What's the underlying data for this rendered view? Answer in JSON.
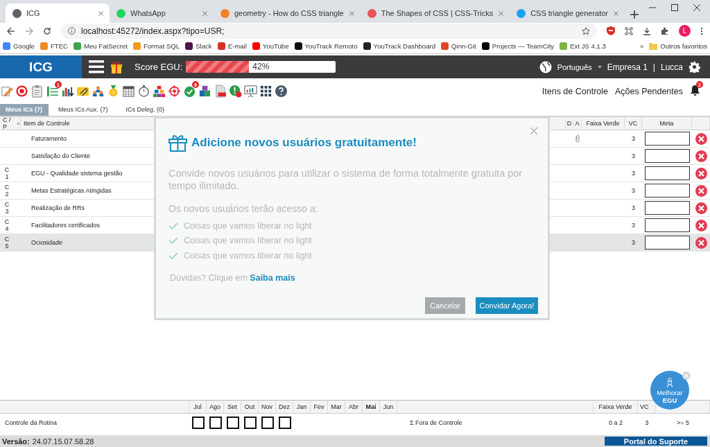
{
  "browser": {
    "tabs": [
      {
        "title": "ICG",
        "color": "#5f6368",
        "selected": true
      },
      {
        "title": "WhatsApp",
        "color": "#25d366",
        "selected": false
      },
      {
        "title": "geometry - How do CSS triangle",
        "color": "#f48024",
        "selected": false
      },
      {
        "title": "The Shapes of CSS | CSS-Tricks",
        "color": "#e8545a",
        "selected": false
      },
      {
        "title": "CSS triangle generator",
        "color": "#1da1f2",
        "selected": false
      }
    ],
    "url": "localhost:45272/index.aspx?tipo=USR;",
    "profile": "L",
    "bookmarks": [
      {
        "label": "Google",
        "color": "#4285f4"
      },
      {
        "label": "FTEC",
        "color": "#f08a24"
      },
      {
        "label": "Meu FatSecret",
        "color": "#3aa64a"
      },
      {
        "label": "Format SQL",
        "color": "#f29a1f"
      },
      {
        "label": "Slack",
        "color": "#4a154b"
      },
      {
        "label": "E-mail",
        "color": "#d93025"
      },
      {
        "label": "YouTube",
        "color": "#ff0000"
      },
      {
        "label": "YouTrack Remoto",
        "color": "#111111"
      },
      {
        "label": "YouTrack Dashboard",
        "color": "#222222"
      },
      {
        "label": "Qinn-Git",
        "color": "#e24329"
      },
      {
        "label": "Projects — TeamCity",
        "color": "#000000"
      },
      {
        "label": "Ext JS 4.1.3",
        "color": "#7cb342"
      }
    ],
    "more": "»",
    "other": "Outros favoritos"
  },
  "app": {
    "logo": "ICG",
    "score_label": "Score EGU:",
    "score": {
      "level": 0.42,
      "reading": "42%"
    },
    "language": "Português",
    "company": "Empresa 1",
    "separator": "|",
    "user": "Lucca"
  },
  "toolbar": {
    "icons": [
      {
        "kind": "pencil"
      },
      {
        "kind": "target"
      },
      {
        "kind": "clipboard"
      },
      {
        "kind": "list",
        "badge": "1"
      },
      {
        "kind": "chart"
      },
      {
        "kind": "paperclip"
      },
      {
        "kind": "people"
      },
      {
        "kind": "medal"
      },
      {
        "kind": "calendar"
      },
      {
        "kind": "stopwatch"
      },
      {
        "kind": "blocks"
      },
      {
        "kind": "crosshair"
      },
      {
        "kind": "check",
        "badge": "9"
      },
      {
        "kind": "puzzle"
      },
      {
        "kind": "pdf"
      },
      {
        "kind": "alert"
      },
      {
        "kind": "board"
      },
      {
        "kind": "grid"
      },
      {
        "kind": "help"
      }
    ],
    "links": [
      "Itens de Controle",
      "Ações Pendentes"
    ],
    "bell_badge": "2"
  },
  "tabs": [
    {
      "label": "Meus ICs (7)",
      "selected": true
    },
    {
      "label": "Meus ICs Aux. (7)",
      "selected": false
    },
    {
      "label": "ICs Deleg. (0)",
      "selected": false
    }
  ],
  "table": {
    "columns": [
      "C / P",
      "Item de Controle",
      "D",
      "A",
      "Faixa Verde",
      "VC",
      "Meta"
    ],
    "rows": [
      {
        "cp": "",
        "item": "Faturamento",
        "attachment": true,
        "vc": "3",
        "selected": false
      },
      {
        "cp": "",
        "item": "Satisfação do Cliente",
        "attachment": false,
        "vc": "3",
        "selected": false
      },
      {
        "cp": "C 1",
        "item": "EGU - Qualidade sistema gestão",
        "attachment": false,
        "vc": "3",
        "selected": false
      },
      {
        "cp": "C 2",
        "item": "Metas Estratégicas Atingidas",
        "attachment": false,
        "vc": "3",
        "selected": false
      },
      {
        "cp": "C 3",
        "item": "Realização de RRs",
        "attachment": false,
        "vc": "3",
        "selected": false
      },
      {
        "cp": "C 4",
        "item": "Facilitadores certificados",
        "attachment": false,
        "vc": "3",
        "selected": false
      },
      {
        "cp": "C 5",
        "item": "Ociosidade",
        "attachment": false,
        "vc": "3",
        "selected": true
      }
    ]
  },
  "modal": {
    "title": "Adicione novos usuários gratuitamente!",
    "text": "Convide novos usuários para utilizar o sistema de forma totalmente gratuita por tempo ilimitado.",
    "subtitle": "Os novos usuários terão acesso a:",
    "benefits": [
      "Coisas que vamos liberar no light",
      "Coisas que vamos liberar no light",
      "Coisas que vamos liberar no light"
    ],
    "help": "Dúvidas? Clique em",
    "help_link": "Saiba mais",
    "buttons": [
      {
        "label": "Cancelar",
        "kind": "secondary"
      },
      {
        "label": "Convidar Agora!",
        "kind": "primary"
      }
    ]
  },
  "bottom": {
    "label": "Controle da Rotina",
    "months": [
      {
        "label": "Jul",
        "selected": false,
        "checked": false
      },
      {
        "label": "Ago",
        "selected": false,
        "checked": false
      },
      {
        "label": "Set",
        "selected": false,
        "checked": false
      },
      {
        "label": "Out",
        "selected": false,
        "checked": false
      },
      {
        "label": "Nov",
        "selected": false,
        "checked": false
      },
      {
        "label": "Dez",
        "selected": false,
        "checked": false
      },
      {
        "label": "Jan",
        "selected": false
      },
      {
        "label": "Fev",
        "selected": false
      },
      {
        "label": "Mar",
        "selected": false
      },
      {
        "label": "Abr",
        "selected": false
      },
      {
        "label": "Mai",
        "selected": true
      },
      {
        "label": "Jun",
        "selected": false
      }
    ],
    "summary": "Σ Fora de Controle",
    "columns": [
      "Faixa Verde",
      "VC"
    ],
    "values": [
      "0 a 2",
      "3",
      ">= 5"
    ]
  },
  "floating": {
    "label": "Melhorar",
    "label_bold": "EGU"
  },
  "status": {
    "version_label": "Versão:",
    "version": "24.07.15.07.58.28",
    "support": "Portal do Suporte"
  }
}
